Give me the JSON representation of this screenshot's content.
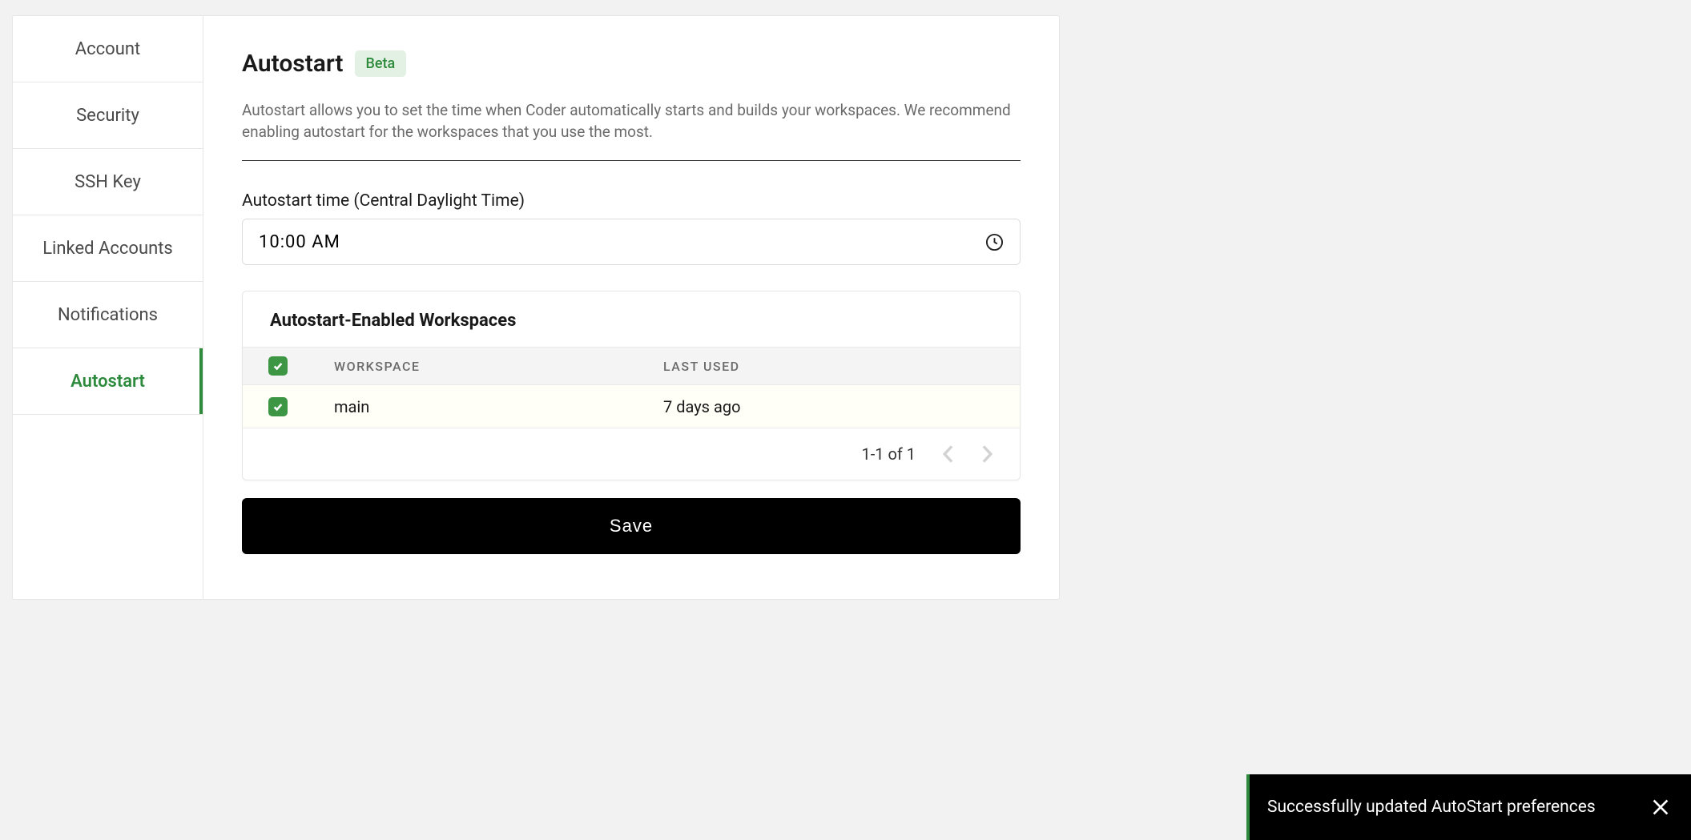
{
  "sidebar": {
    "items": [
      {
        "label": "Account"
      },
      {
        "label": "Security"
      },
      {
        "label": "SSH Key"
      },
      {
        "label": "Linked Accounts"
      },
      {
        "label": "Notifications"
      },
      {
        "label": "Autostart"
      }
    ],
    "activeIndex": 5
  },
  "page": {
    "title": "Autostart",
    "badge": "Beta",
    "description": "Autostart allows you to set the time when Coder automatically starts and builds your workspaces. We recommend enabling autostart for the workspaces that you use the most."
  },
  "timeField": {
    "label": "Autostart time (Central Daylight Time)",
    "value": "10:00 AM"
  },
  "workspacesCard": {
    "title": "Autostart-Enabled Workspaces",
    "columns": {
      "workspace": "WORKSPACE",
      "lastUsed": "LAST USED"
    },
    "rows": [
      {
        "name": "main",
        "lastUsed": "7 days ago",
        "checked": true
      }
    ],
    "pagination": "1-1 of 1"
  },
  "saveLabel": "Save",
  "toast": {
    "message": "Successfully updated AutoStart preferences"
  }
}
